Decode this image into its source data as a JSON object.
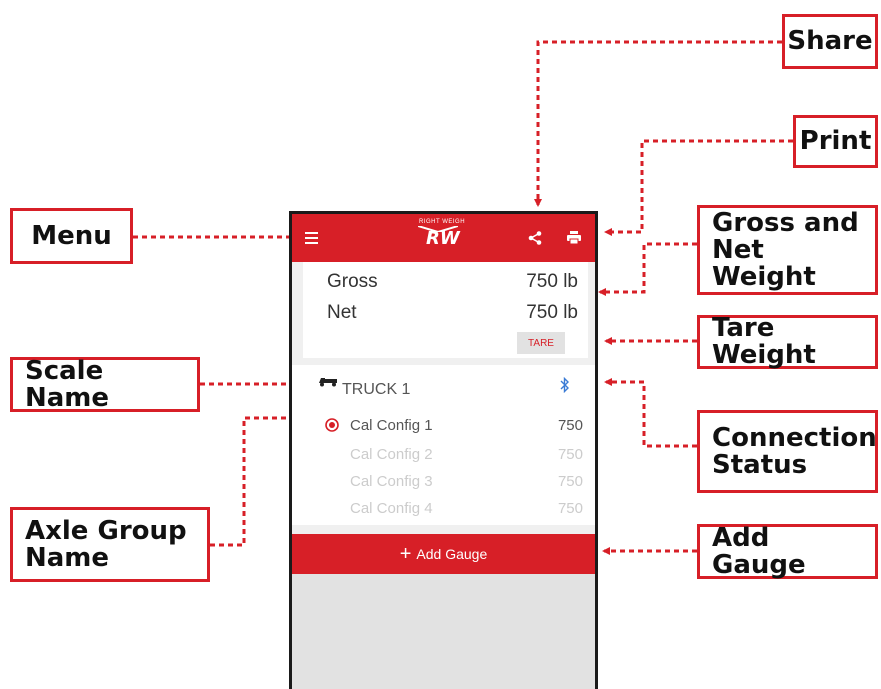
{
  "callouts": {
    "share": "Share",
    "print": "Print",
    "menu": "Menu",
    "gross_net_line1": "Gross and",
    "gross_net_line2": "Net Weight",
    "tare_weight": "Tare Weight",
    "scale_name": "Scale Name",
    "connection_line1": "Connection",
    "connection_line2": "Status",
    "axle_line1": "Axle Group",
    "axle_line2": "Name",
    "add_gauge": "Add Gauge"
  },
  "app": {
    "logo_text": "RIGHT WEIGH",
    "logo_mark": "RW",
    "icons": {
      "menu": "menu-icon",
      "share": "share-icon",
      "print": "print-icon",
      "truck": "truck-icon",
      "bluetooth": "bluetooth-icon",
      "radio": "radio-selected-icon"
    },
    "weights": {
      "gross_label": "Gross",
      "gross_value": "750 lb",
      "net_label": "Net",
      "net_value": "750 lb",
      "tare_button": "TARE"
    },
    "scale": {
      "name": "TRUCK 1",
      "configs": [
        {
          "name": "Cal Config 1",
          "value": "750",
          "selected": true
        },
        {
          "name": "Cal Config 2",
          "value": "750",
          "selected": false
        },
        {
          "name": "Cal Config 3",
          "value": "750",
          "selected": false
        },
        {
          "name": "Cal Config 4",
          "value": "750",
          "selected": false
        }
      ]
    },
    "add_gauge_label": "Add Gauge"
  },
  "colors": {
    "accent": "#d71f27",
    "bluetooth": "#3a7bd5"
  }
}
